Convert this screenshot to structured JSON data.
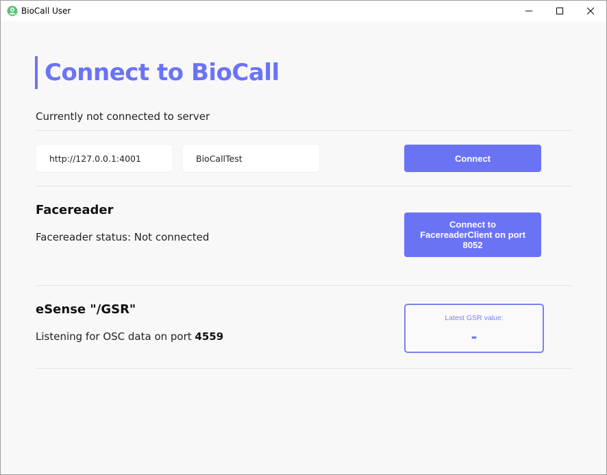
{
  "window": {
    "title": "BioCall User",
    "icon": "biocall-app-icon"
  },
  "page": {
    "title": "Connect to BioCall",
    "server_status": "Currently not connected to server"
  },
  "connection": {
    "server_url": "http://127.0.0.1:4001",
    "room_name": "BioCallTest",
    "connect_label": "Connect"
  },
  "facereader": {
    "title": "Facereader",
    "status_text": "Facereader status: Not connected",
    "connect_label": "Connect to FacereaderClient on port 8052"
  },
  "esense": {
    "title": "eSense \"/GSR\"",
    "listening_prefix": "Listening for OSC data on port ",
    "port": "4559",
    "gsr_label": "Latest GSR value:",
    "gsr_value": "-"
  },
  "colors": {
    "accent": "#6b73f5",
    "background": "#f8f8f9",
    "divider": "#e4e4e6"
  }
}
